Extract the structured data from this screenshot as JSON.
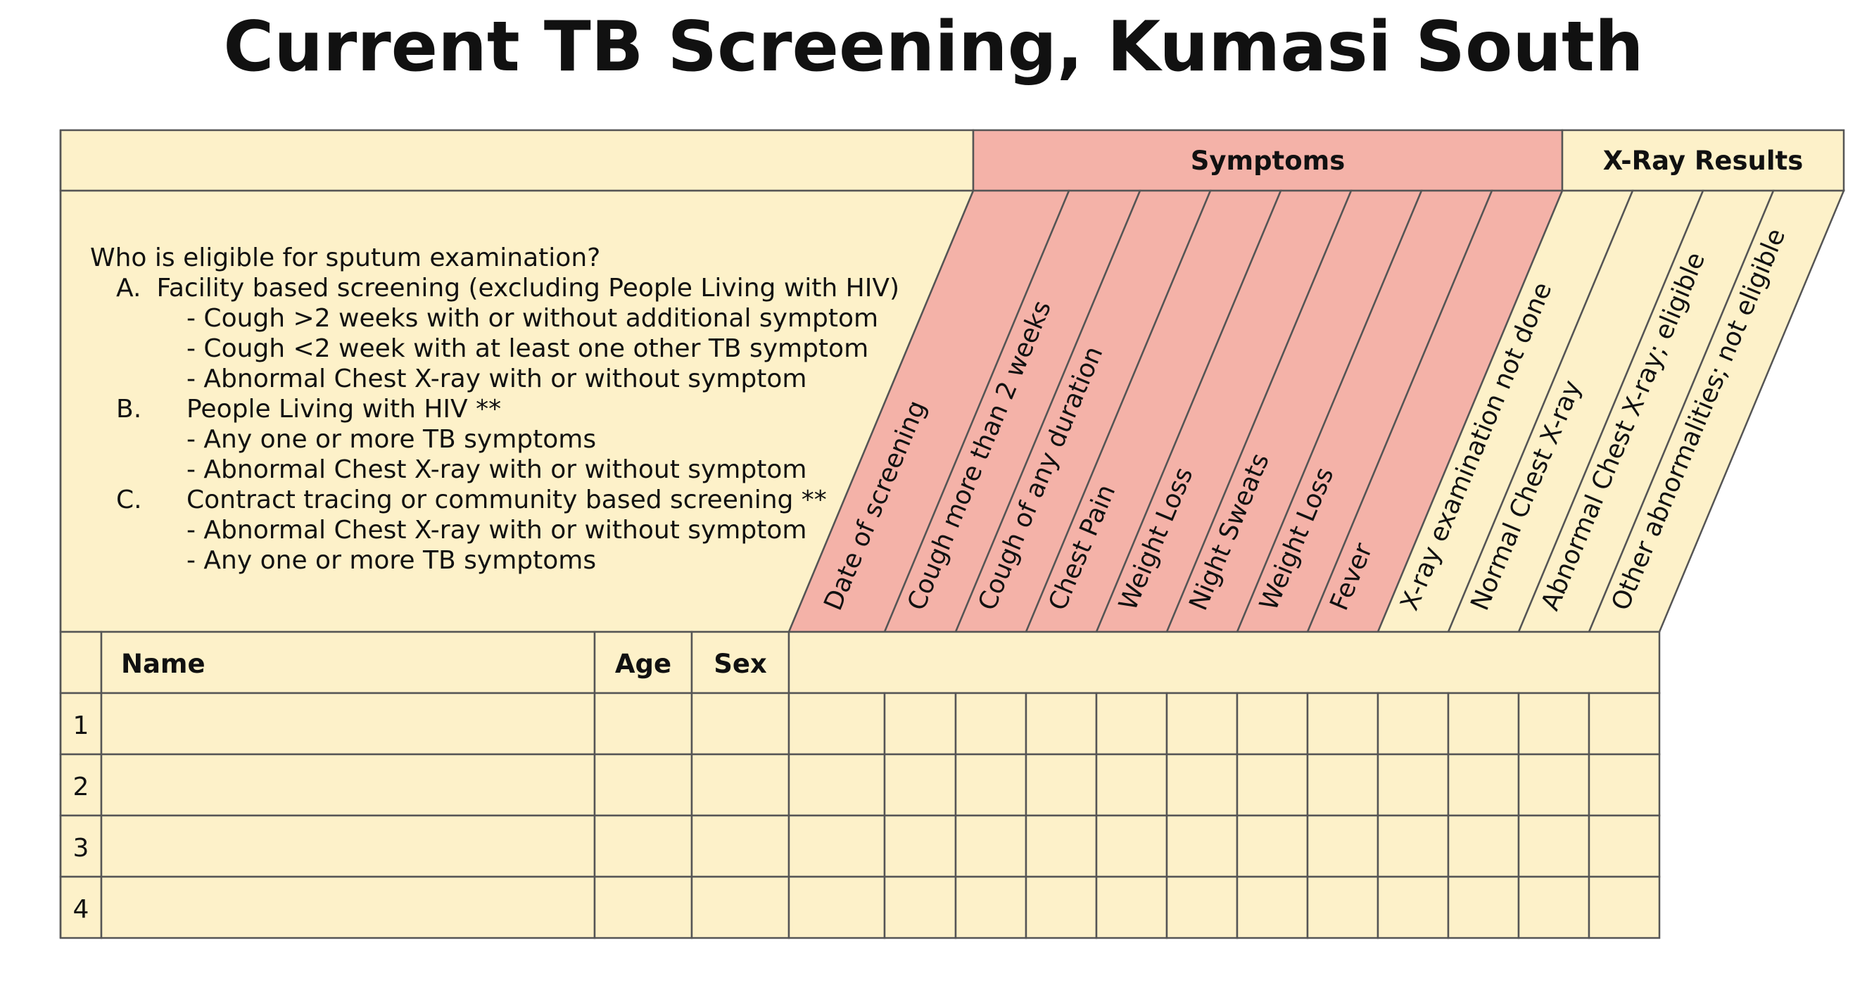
{
  "title": "Current TB Screening, Kumasi South",
  "colors": {
    "cream": "#fdf1c9",
    "pink": "#f4b2a8",
    "border": "#555555"
  },
  "groups": {
    "symptoms": "Symptoms",
    "xray": "X-Ray Results"
  },
  "eligibility": {
    "question": "Who is eligible for sputum examination?",
    "items": [
      {
        "letter": "A.",
        "text": "Facility based screening (excluding People Living with HIV)",
        "subs": [
          "- Cough >2 weeks with or without additional symptom",
          "- Cough <2 week with at least one other TB symptom",
          "- Abnormal Chest X-ray with or without symptom"
        ]
      },
      {
        "letter": "B.",
        "text": "People Living with HIV **",
        "subs": [
          "- Any one or more TB symptoms",
          "- Abnormal Chest X-ray with or without symptom"
        ]
      },
      {
        "letter": "C.",
        "text": "Contract tracing or community based screening **",
        "subs": [
          "- Abnormal Chest X-ray with or without symptom",
          "- Any one or more TB symptoms"
        ]
      }
    ]
  },
  "columns": {
    "name": "Name",
    "age": "Age",
    "sex": "Sex",
    "diagonal": [
      {
        "label": "Date of screening",
        "group": "symptoms"
      },
      {
        "label": "Cough more than 2 weeks",
        "group": "symptoms"
      },
      {
        "label": "Cough of any duration",
        "group": "symptoms"
      },
      {
        "label": "Chest Pain",
        "group": "symptoms"
      },
      {
        "label": "Weight Loss",
        "group": "symptoms"
      },
      {
        "label": "Night Sweats",
        "group": "symptoms"
      },
      {
        "label": "Weight Loss",
        "group": "symptoms"
      },
      {
        "label": "Fever",
        "group": "symptoms"
      },
      {
        "label": "X-ray examination not done",
        "group": "xray"
      },
      {
        "label": "Normal Chest X-ray",
        "group": "xray"
      },
      {
        "label": "Abnormal Chest X-ray; eligible",
        "group": "xray"
      },
      {
        "label": "Other abnormalities; not eligible",
        "group": "xray"
      }
    ]
  },
  "rows": [
    "1",
    "2",
    "3",
    "4"
  ]
}
